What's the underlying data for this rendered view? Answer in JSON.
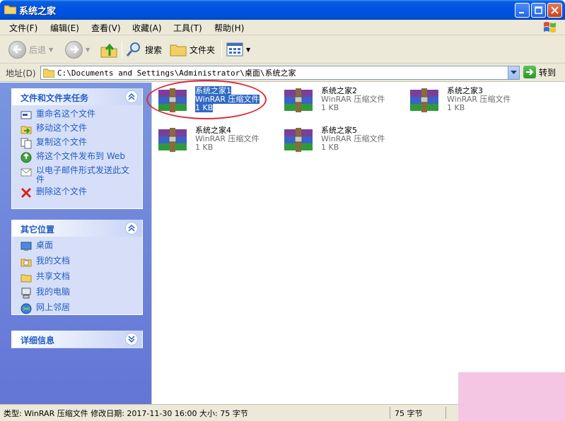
{
  "window": {
    "title": "系统之家"
  },
  "menu": [
    "文件(F)",
    "编辑(E)",
    "查看(V)",
    "收藏(A)",
    "工具(T)",
    "帮助(H)"
  ],
  "toolbar": {
    "back": "后退",
    "search": "搜索",
    "folders": "文件夹"
  },
  "address": {
    "label": "地址(D)",
    "path": "C:\\Documents and Settings\\Administrator\\桌面\\系统之家",
    "go": "转到"
  },
  "tasks_panel": {
    "title": "文件和文件夹任务",
    "items": [
      "重命名这个文件",
      "移动这个文件",
      "复制这个文件",
      "将这个文件发布到 Web",
      "以电子邮件形式发送此文件",
      "删除这个文件"
    ]
  },
  "places_panel": {
    "title": "其它位置",
    "items": [
      "桌面",
      "我的文档",
      "共享文档",
      "我的电脑",
      "网上邻居"
    ]
  },
  "details_panel": {
    "title": "详细信息"
  },
  "files": [
    {
      "name": "系统之家1",
      "type": "WinRAR 压缩文件",
      "size": "1 KB"
    },
    {
      "name": "系统之家2",
      "type": "WinRAR 压缩文件",
      "size": "1 KB"
    },
    {
      "name": "系统之家3",
      "type": "WinRAR 压缩文件",
      "size": "1 KB"
    },
    {
      "name": "系统之家4",
      "type": "WinRAR 压缩文件",
      "size": "1 KB"
    },
    {
      "name": "系统之家5",
      "type": "WinRAR 压缩文件",
      "size": "1 KB"
    }
  ],
  "status": {
    "info": "类型: WinRAR 压缩文件 修改日期: 2017-11-30 16:00 大小: 75 字节",
    "size": "75 字节"
  }
}
